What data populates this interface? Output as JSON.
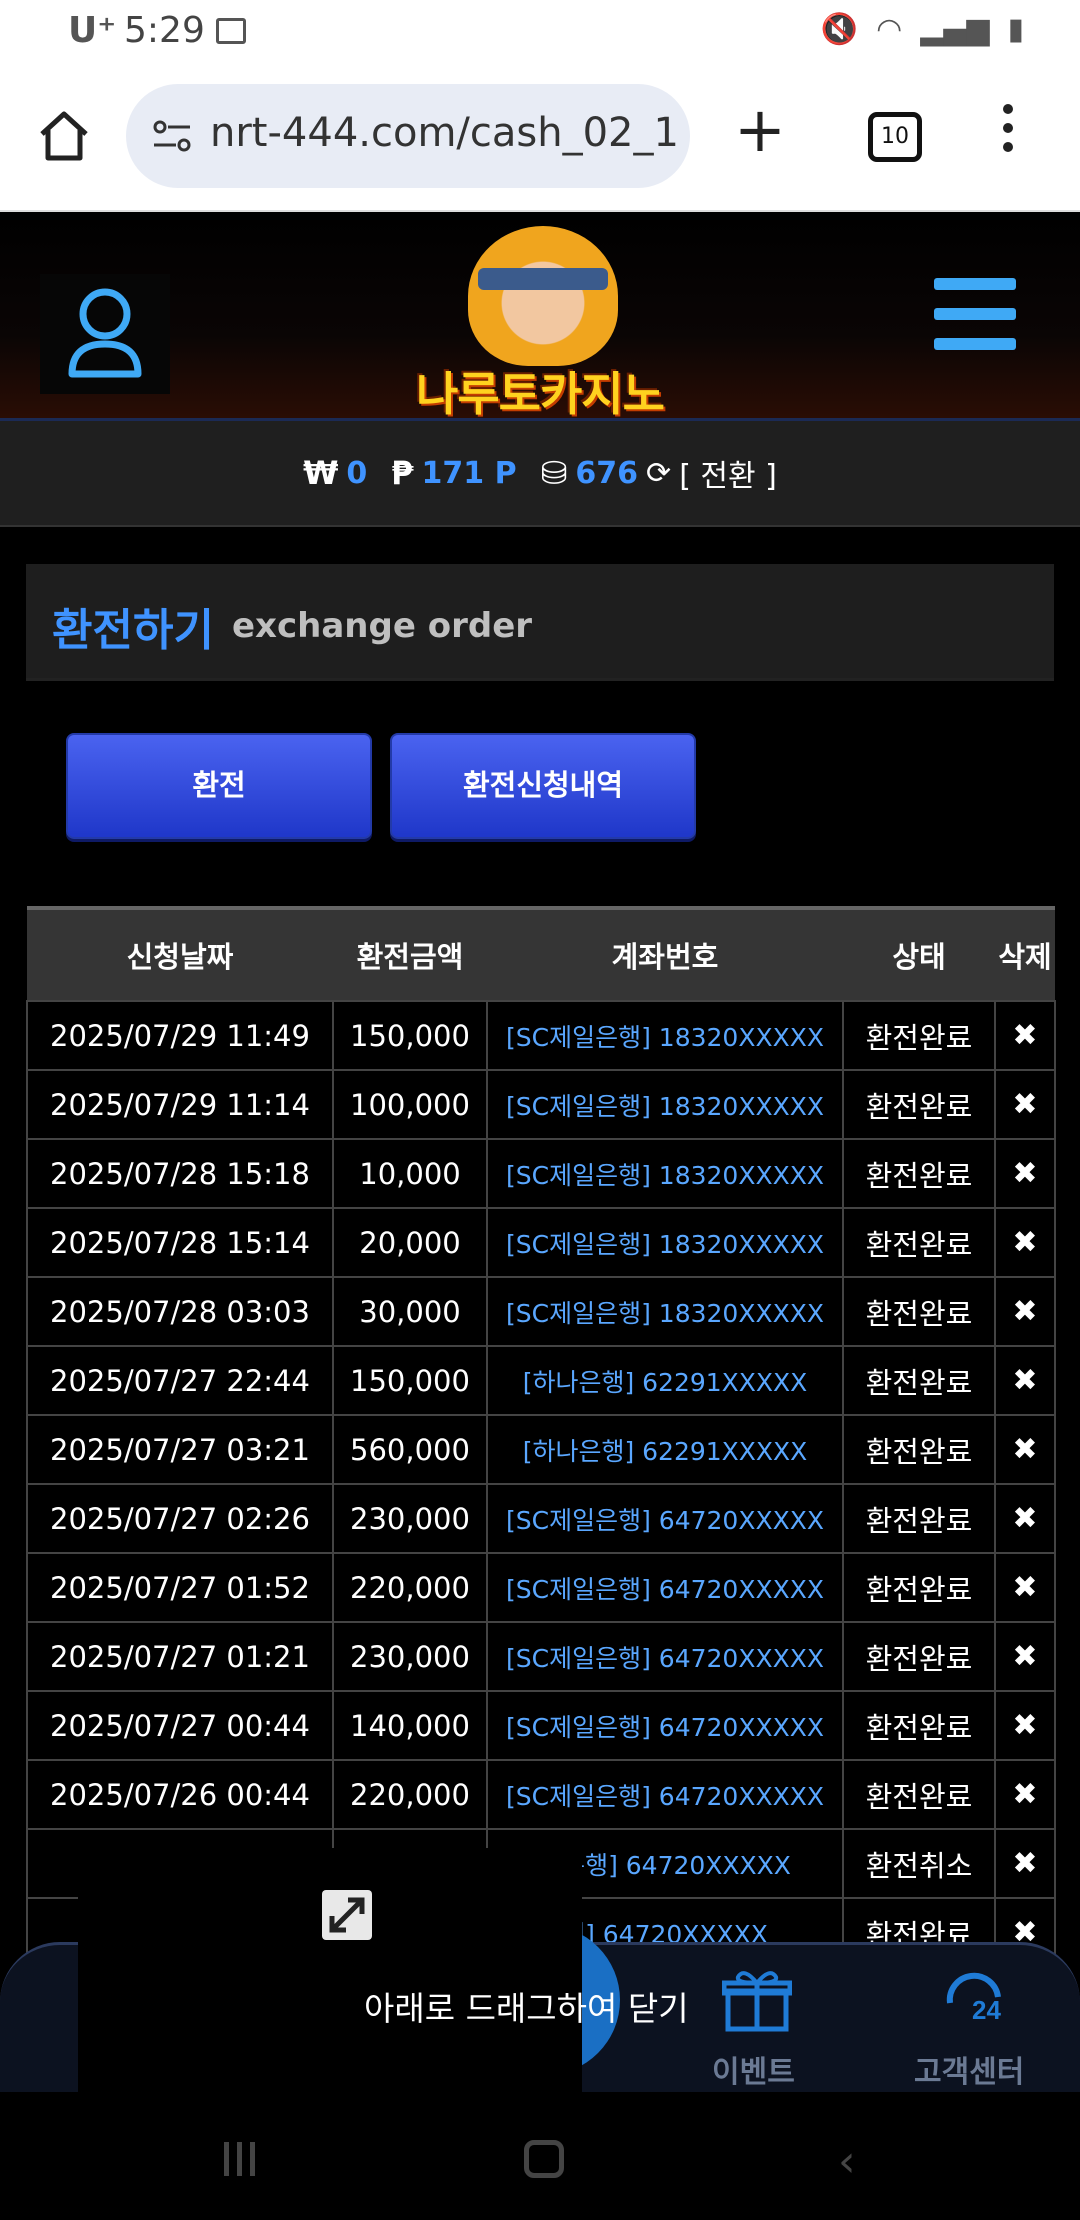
{
  "status_bar": {
    "carrier": "U⁺",
    "time": "5:29"
  },
  "browser": {
    "url": "nrt-444.com/cash_02_1",
    "tab_count": "10"
  },
  "site": {
    "logo_text": "나루토카지노"
  },
  "balance": {
    "won_symbol": "₩",
    "won_value": "0",
    "point_symbol": "₱",
    "point_value": "171 P",
    "chip_value": "676",
    "toggle_label": "[ 전환 ]"
  },
  "section": {
    "title_ko": "환전하기",
    "title_en": "exchange order"
  },
  "buttons": {
    "exchange": "환전",
    "history": "환전신청내역"
  },
  "table": {
    "headers": [
      "신청날짜",
      "환전금액",
      "계좌번호",
      "상태",
      "삭제"
    ],
    "rows": [
      {
        "date": "2025/07/29 11:49",
        "amount": "150,000",
        "account": "[SC제일은행] 18320XXXXX",
        "status": "환전완료",
        "del": "✖"
      },
      {
        "date": "2025/07/29 11:14",
        "amount": "100,000",
        "account": "[SC제일은행] 18320XXXXX",
        "status": "환전완료",
        "del": "✖"
      },
      {
        "date": "2025/07/28 15:18",
        "amount": "10,000",
        "account": "[SC제일은행] 18320XXXXX",
        "status": "환전완료",
        "del": "✖"
      },
      {
        "date": "2025/07/28 15:14",
        "amount": "20,000",
        "account": "[SC제일은행] 18320XXXXX",
        "status": "환전완료",
        "del": "✖"
      },
      {
        "date": "2025/07/28 03:03",
        "amount": "30,000",
        "account": "[SC제일은행] 18320XXXXX",
        "status": "환전완료",
        "del": "✖"
      },
      {
        "date": "2025/07/27 22:44",
        "amount": "150,000",
        "account": "[하나은행] 62291XXXXX",
        "status": "환전완료",
        "del": "✖"
      },
      {
        "date": "2025/07/27 03:21",
        "amount": "560,000",
        "account": "[하나은행] 62291XXXXX",
        "status": "환전완료",
        "del": "✖"
      },
      {
        "date": "2025/07/27 02:26",
        "amount": "230,000",
        "account": "[SC제일은행] 64720XXXXX",
        "status": "환전완료",
        "del": "✖"
      },
      {
        "date": "2025/07/27 01:52",
        "amount": "220,000",
        "account": "[SC제일은행] 64720XXXXX",
        "status": "환전완료",
        "del": "✖"
      },
      {
        "date": "2025/07/27 01:21",
        "amount": "230,000",
        "account": "[SC제일은행] 64720XXXXX",
        "status": "환전완료",
        "del": "✖"
      },
      {
        "date": "2025/07/27 00:44",
        "amount": "140,000",
        "account": "[SC제일은행] 64720XXXXX",
        "status": "환전완료",
        "del": "✖"
      },
      {
        "date": "2025/07/26 00:44",
        "amount": "220,000",
        "account": "[SC제일은행] 64720XXXXX",
        "status": "환전완료",
        "del": "✖"
      },
      {
        "date": "20",
        "amount": "",
        "account": "일은행] 64720XXXXX",
        "status": "환전취소",
        "del": "✖"
      },
      {
        "date": "20",
        "amount": "",
        "account": "행] 64720XXXXX",
        "status": "환전완료",
        "del": "✖"
      }
    ]
  },
  "overlay": {
    "drag_hint": "아래로 드래그하여 닫기"
  },
  "bottom_nav": {
    "event_label": "이벤트",
    "support_label": "고객센터"
  }
}
